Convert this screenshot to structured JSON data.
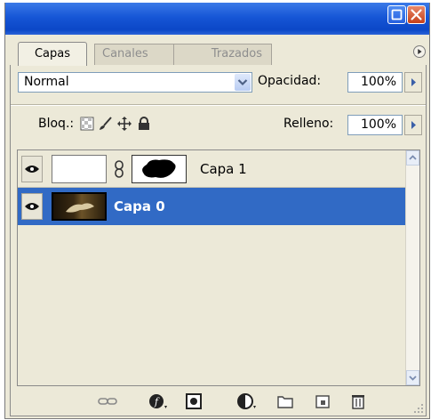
{
  "tabs": [
    {
      "label": "Capas",
      "active": true
    },
    {
      "label": "Canales",
      "active": false
    },
    {
      "label": "Trazados",
      "active": false
    }
  ],
  "blend_mode": {
    "value": "Normal",
    "options_visible": false
  },
  "opacity": {
    "label": "Opacidad:",
    "value": "100%"
  },
  "lock": {
    "label": "Bloq.:",
    "icons": [
      "lock-transparent-icon",
      "lock-brush-icon",
      "lock-move-icon",
      "lock-all-icon"
    ]
  },
  "fill": {
    "label": "Relleno:",
    "value": "100%"
  },
  "layers": [
    {
      "name": "Capa 1",
      "visible": true,
      "selected": false,
      "has_mask": true,
      "linked": true
    },
    {
      "name": "Capa 0",
      "visible": true,
      "selected": true,
      "has_mask": false,
      "linked": false
    }
  ],
  "bottom_icons": [
    "link-layers-icon",
    "layer-style-icon",
    "add-mask-icon",
    "adjustment-layer-icon",
    "new-group-icon",
    "new-layer-icon",
    "delete-layer-icon"
  ],
  "colors": {
    "titlebar": "#1656d6",
    "selection": "#316ac5",
    "panel_bg": "#ece9d8"
  }
}
